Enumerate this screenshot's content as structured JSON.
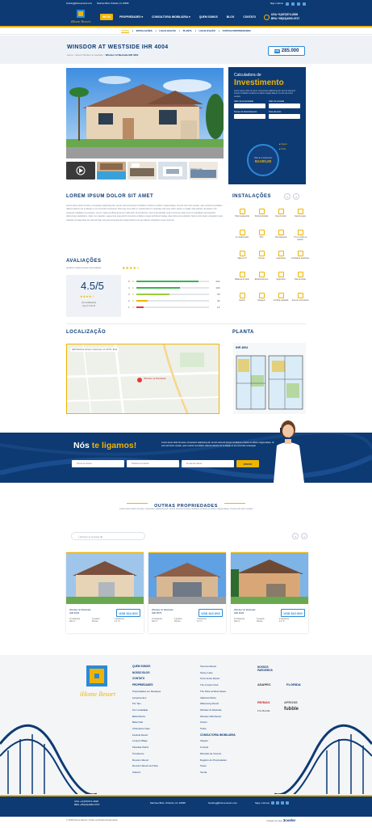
{
  "topbar": {
    "email": "booking@ihomeresort.com",
    "address": "Melrose Blvd. Orlando, FL 32835",
    "follow": "Siga o iHome"
  },
  "header": {
    "logo_text": "iHome Resort",
    "nav": [
      "INÍCIO",
      "PROPRIEDADES",
      "CONSULTORIA IMOBILIÁRIA",
      "QUEM SOMOS",
      "BLOG",
      "CONTATO"
    ],
    "phone_usa": "USA +1(407)574-2828",
    "phone_bra": "BRA +55(31)4090-0737"
  },
  "tabs": [
    "FOTOS",
    "INSTALAÇÕES",
    "LOCALIZAÇÃO",
    "PLANTA",
    "LOCALIZAÇÃO",
    "OUTRAS PROPRIEDADES"
  ],
  "property": {
    "title": "WINSDOR AT WESTSIDE IHR 4004",
    "breadcrumb_home": "Home",
    "breadcrumb_mid": "Resort Windsor at westside",
    "breadcrumb_current": "Windsor At Westside IHR 4004",
    "currency": "US$",
    "price": "285.000",
    "more_photos": "Veras Lua"
  },
  "calculator": {
    "kicker": "Calculadora de",
    "title": "Investimento",
    "desc": "Lorem ipsum dolor sit amet, consectetur adipiscing elit, sed do eiusmod tempor incididunt ut labore et dolore magna aliqua. Ut enim ad minim veniam.",
    "label_value": "Valor da propriedade",
    "label_entry": "Valor de entrada",
    "label_term": "Tempo de financiamento",
    "label_rate": "Taxa de juros",
    "circle_label": "Valor de investimento",
    "circle_value": "50.000,00",
    "pct_top": "Seguro",
    "pct_bottom": "Taxas"
  },
  "about": {
    "heading": "LOREM IPSUM DOLOR SIT AMET",
    "text": "Lorem ipsum dolor sit amet, consectetur adipiscing elit, sed do eiusmod tempor incididunt ut labore et dolore magna aliqua. Ut enim ad minim veniam, quis nostrud exercitation ullamco laboris nisi ut aliquip ex ea commodo consequat. Duis aute irure dolor in reprehenderit in voluptate velit esse cillum dolore eu fugiat nulla pariatur. Excepteur sint occaecat cupidatat non proident, sunt in culpa qui officia deserunt mollit anim id est laborum. Sed ut perspiciatis unde omnis iste natus error sit voluptatem accusantium doloremque laudantium, totam rem aperiam, eaque ipsa quae ab illo inventore veritatis et quasi architecto beatae vitae dicta sunt explicabo. Nemo enim ipsam voluptatem quia voluptas sit aspernatur aut odit aut fugit, sed quia consequuntur magni dolores eos qui ratione voluptatem sequi nesciunt."
  },
  "ratings": {
    "heading": "AVALIAÇÕES",
    "subtitle": "Qualisol média avessa propriedades",
    "score": "4.5/5",
    "count": "(14 avaliações)",
    "updated": "Avg 4.0 de 5)",
    "rows": [
      {
        "stars": "5",
        "count": "224",
        "fill": 0.85,
        "color": "#3bb44a"
      },
      {
        "stars": "4",
        "count": "100",
        "fill": 0.6,
        "color": "#3bb44a"
      },
      {
        "stars": "3",
        "count": "50",
        "fill": 0.45,
        "color": "#9ccc3c"
      },
      {
        "stars": "2",
        "count": "32",
        "fill": 0.15,
        "color": "#f0b400"
      },
      {
        "stars": "1",
        "count": "12",
        "fill": 0.1,
        "color": "#e53935"
      }
    ]
  },
  "amenities": {
    "heading": "INSTALAÇÕES",
    "items": [
      "Piscina aquecida",
      "Piscina privativa",
      "Área de lazer",
      "Sala de jogos",
      "Ar condicionado",
      "Wi-fi",
      "Churrasqueira",
      "TV em todos os quartos",
      "Sala de TV",
      "Internet",
      "Lavanderia",
      "Fechadura eletrônica",
      "Máquina de lavar",
      "Estacionamento",
      "Segurança",
      "Sala de jantar",
      "Jacuzzi",
      "Garagem",
      "Cozinha equipada",
      "Área de convivência"
    ]
  },
  "location": {
    "heading": "LOCALIZAÇÃO",
    "address": "2000 Melrose Terrace, Kissimmee, FL 34747, EUA",
    "pin_label": "Windsor at Westside"
  },
  "plan": {
    "heading": "PLANTA",
    "label": "IHR 4004"
  },
  "callback": {
    "title_a": "Nós",
    "title_b": "te ligamos!",
    "desc": "Lorem ipsum dolor sit amet, consectetur adipiscing elit, sed do eiusmod tempor incididunt ut labore et dolore magna aliqua. Ut enim ad minim veniam, quis nostrud exercitation ullamco laboris nisi ut aliquip ex ea commodo consequat.",
    "name_ph": "Nome do cliente",
    "phone_ph": "Telefone do cliente",
    "email_ph": "E-mail do cliente",
    "button": "ENVIAR"
  },
  "others": {
    "heading": "OUTRAS PROPRIEDADES",
    "desc": "Lorem ipsum dolor sit amet, consectetur adipiscing elit, sed do eiusmod tempor incididunt ut labore et dolore magna aliqua. Ut enim ad minim veniam.",
    "filter": "Windsor at westside (8)",
    "cards": [
      {
        "name": "Windsor At Westside",
        "code": "IHR 4004",
        "price": "US$ 322.000",
        "f1": "10 hóspedes",
        "f2": "5 quartos",
        "f3": "4 banheiros",
        "f4": "200 m²",
        "f5": "Piscina",
        "f6": "4.5 / 5"
      },
      {
        "name": "Windsor At Westside",
        "code": "IHR 3575",
        "price": "US$ 322.000",
        "f1": "10 hóspedes",
        "f2": "5 quartos",
        "f3": "4 banheiros",
        "f4": "200 m²",
        "f5": "Piscina",
        "f6": "4.5 / 5"
      },
      {
        "name": "Windsor At Westside",
        "code": "IHR 4004",
        "price": "US$ 322.000",
        "f1": "10 hóspedes",
        "f2": "5 quartos",
        "f3": "4 banheiros",
        "f4": "200 m²",
        "f5": "Piscina",
        "f6": "4.5 / 5"
      }
    ]
  },
  "footer": {
    "col1": [
      "QUEM SOMOS",
      "NOSSO BLOG",
      "CONTATO",
      "PROPRIEDADES",
      "Propriedades em Destaque",
      "Lançamentos",
      "Por Tipo",
      "Por Localidade",
      "Bella Piazza",
      "Bella Vida",
      "Champions Gate",
      "Festival Resort",
      "Lucaya Village",
      "Paradise Palms",
      "Providence",
      "Reunion Resort",
      "Reunion Resort and Spa",
      "Solterra"
    ],
    "col2": [
      "Sonoma Resort",
      "Storey Lake",
      "Terra Verde Resort",
      "The Crossin Club",
      "The Shire at West Haven",
      "Valencia Palms",
      "Watersong Resort",
      "Windsor At Westside",
      "Windsor Hills Resort",
      "Outros",
      "Todos",
      "CONSULTORIA IMOBILIÁRIA",
      "Aluguel",
      "Compra",
      "Mercado de Imóveis",
      "Registro de Propriedades",
      "Taxas",
      "Venda"
    ],
    "partners_title": "NOSSOS PARCEIROS",
    "partners": [
      "ASAPEC",
      "FLORIDA",
      "RE/MAX",
      "AFROSS",
      "Fox Rental",
      "fubble"
    ],
    "phone_usa": "USA +1(407)574-2828",
    "phone_bra": "BRA +55(31)4090-0737",
    "address": "Melrose Blvd. Orlando, FL 32835",
    "email": "booking@ihomeresort.com",
    "follow": "Siga o iHome",
    "copyright": "© 2018 iHome Resort | Todos os Direitos Reservados",
    "made_by": "Criação de sites",
    "agency": "3coeler"
  }
}
